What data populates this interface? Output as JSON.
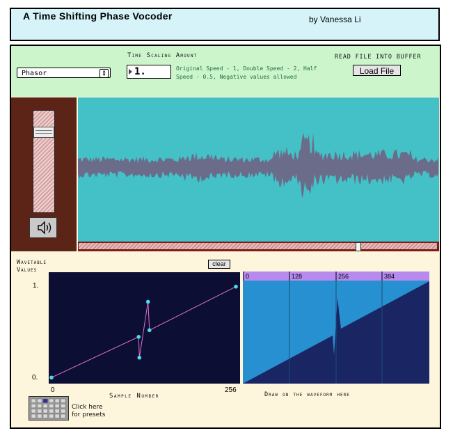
{
  "header": {
    "title": "A Time Shifting Phase Vocoder",
    "author": "by Vanessa Li"
  },
  "controls": {
    "mode_select_value": "Phasor",
    "time_scaling_label": "Time Scaling Amount",
    "time_scaling_value": "1.",
    "time_scaling_help": "Original Speed - 1, Double Speed - 2, Half Speed - 0.5, Negative values allowed",
    "read_file_label": "READ FILE INTO BUFFER",
    "load_button_label": "Load File"
  },
  "volume": {
    "level": 0.82
  },
  "waveform": {
    "playhead_position": 0.78,
    "fill_color": "#6b6b8a",
    "background_color": "#44c1c6"
  },
  "wavetable": {
    "label_line1": "Wavetable",
    "label_line2": "Values",
    "clear_label": "clear",
    "y_max_label": "1.",
    "y_min_label": "0.",
    "x_min_label": "0",
    "x_max_label": "256",
    "x_axis_label": "Sample Number",
    "line_color": "#e074d0",
    "point_color": "#50d8f0",
    "points": [
      [
        0,
        0.02
      ],
      [
        121,
        0.45
      ],
      [
        122,
        0.23
      ],
      [
        134,
        0.82
      ],
      [
        136,
        0.52
      ],
      [
        256,
        0.98
      ]
    ]
  },
  "draw_waveform": {
    "ruler_labels": [
      "0",
      "128",
      "256",
      "384"
    ],
    "caption": "Draw on the waveform here",
    "ruler_color": "#b88aee"
  },
  "presets": {
    "caption_line1": "Click here",
    "caption_line2": "for presets"
  }
}
